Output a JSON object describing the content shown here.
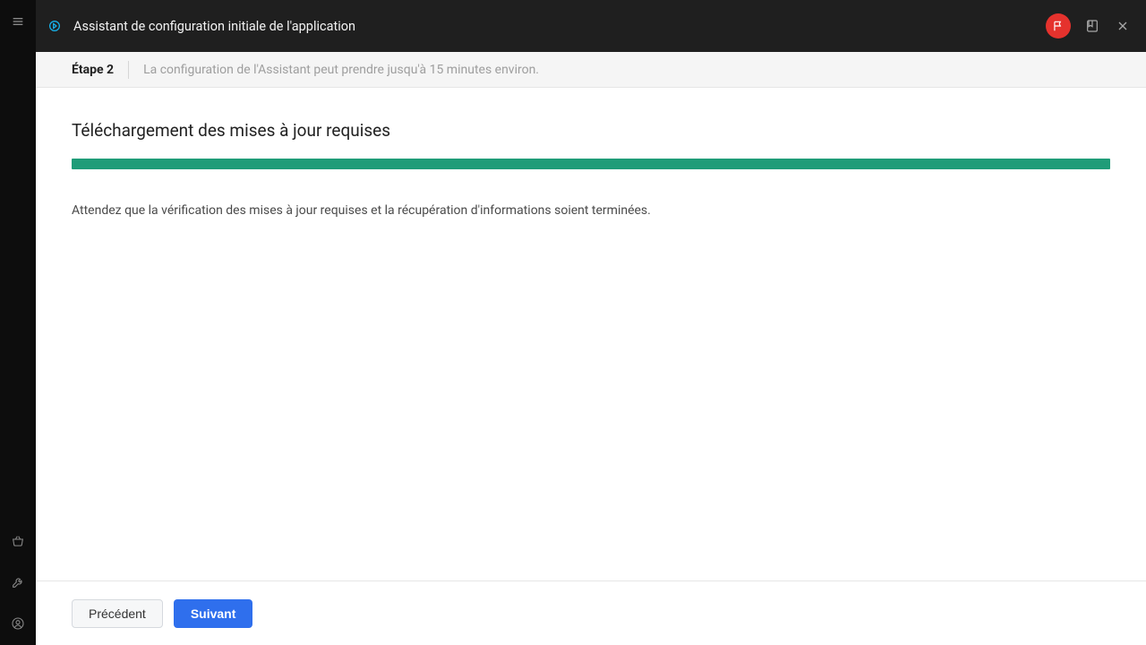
{
  "header": {
    "title": "Assistant de configuration initiale de l'application"
  },
  "step": {
    "label": "Étape 2",
    "description": "La configuration de l'Assistant peut prendre jusqu'à 15 minutes environ."
  },
  "content": {
    "section_title": "Téléchargement des mises à jour requises",
    "wait_text": "Attendez que la vérification des mises à jour requises et la récupération d'informations soient terminées.",
    "progress_percent": 100
  },
  "buttons": {
    "back": "Précédent",
    "next": "Suivant"
  },
  "colors": {
    "progress": "#1f9c78",
    "primary": "#2f6fed",
    "flag_badge": "#e5322d"
  }
}
